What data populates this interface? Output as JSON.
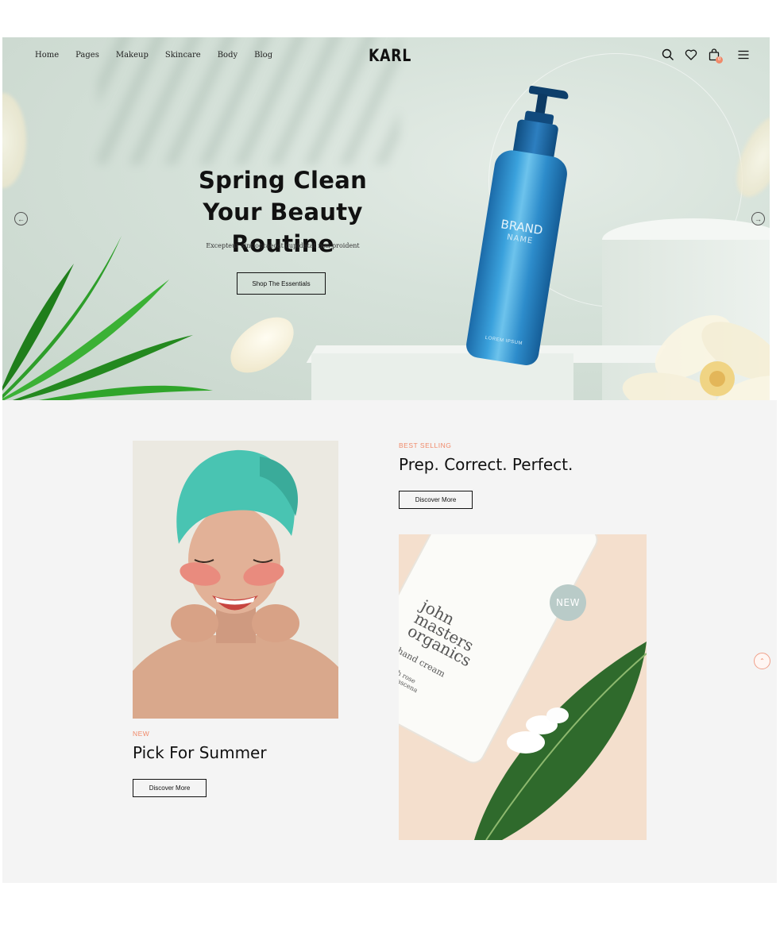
{
  "nav": {
    "links": [
      "Home",
      "Pages",
      "Makeup",
      "Skincare",
      "Body",
      "Blog"
    ],
    "logo": "KARL",
    "icons": [
      "search-icon",
      "heart-icon",
      "cart-icon",
      "menu-icon"
    ],
    "cart_count": "0"
  },
  "hero": {
    "title_line1": "Spring Clean",
    "title_line2": "Your Beauty Routine",
    "subtitle": "Excepteur sint occaecat cupidatat non proident",
    "button": "Shop The Essentials",
    "bottle_brand": "BRAND",
    "bottle_name": "NAME",
    "bottle_footer": "LOREM IPSUM"
  },
  "features": {
    "left": {
      "tag": "NEW",
      "title": "Pick For Summer",
      "button": "Discover More"
    },
    "right": {
      "tag": "BEST SELLING",
      "title": "Prep. Correct. Perfect.",
      "button": "Discover More",
      "badge": "NEW"
    },
    "tube_text": {
      "brand_line1": "john",
      "brand_line2": "masters",
      "brand_line3": "organics",
      "product": "hand cream",
      "variant1": "with rose",
      "variant2": "damascena"
    }
  },
  "colors": {
    "accent": "#f08a6a",
    "hero_bg": "#d6e2da",
    "section_bg": "#f4f4f4"
  }
}
